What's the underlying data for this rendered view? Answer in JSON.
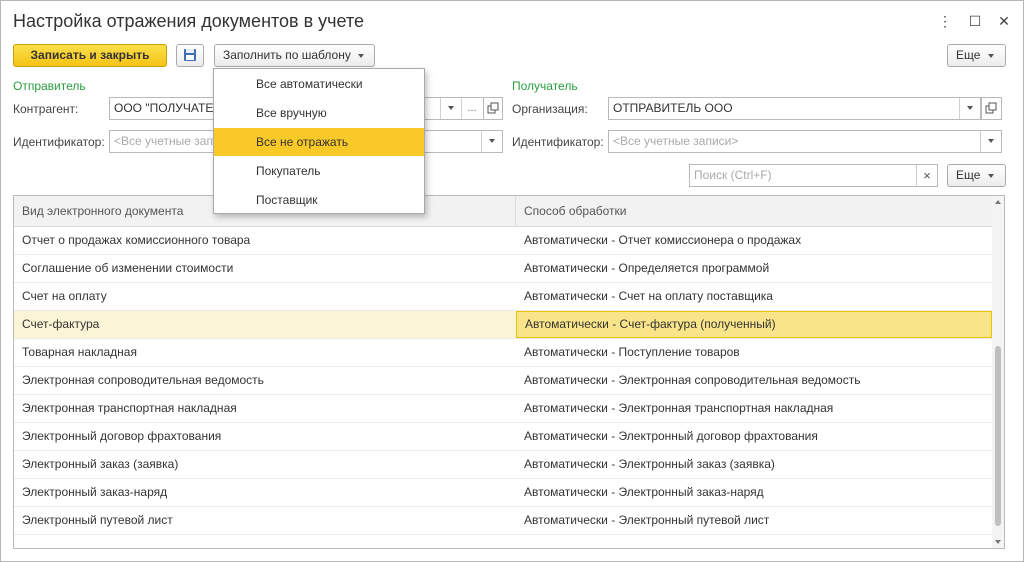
{
  "window": {
    "title": "Настройка отражения документов в учете",
    "menu_icon": "⋮",
    "maximize_icon": "☐",
    "close_icon": "✕"
  },
  "toolbar": {
    "save_close_label": "Записать и закрыть",
    "save_icon": "floppy-disk-icon",
    "fill_template_label": "Заполнить по шаблону",
    "more_label": "Еще"
  },
  "template_menu": {
    "items": [
      "Все автоматически",
      "Все вручную",
      "Все не отражать",
      "Покупатель",
      "Поставщик"
    ],
    "highlighted_index": 2
  },
  "sender": {
    "section_title": "Отправитель",
    "counterparty_label": "Контрагент:",
    "counterparty_value": "ООО \"ПОЛУЧАТЕЛЬ\"",
    "identifier_label": "Идентификатор:",
    "identifier_placeholder": "<Все учетные записи>"
  },
  "receiver": {
    "section_title": "Получатель",
    "organization_label": "Организация:",
    "organization_value": "ОТПРАВИТЕЛЬ ООО",
    "identifier_label": "Идентификатор:",
    "identifier_placeholder": "<Все учетные записи>"
  },
  "search": {
    "placeholder": "Поиск (Ctrl+F)",
    "clear_icon": "×",
    "more_label": "Еще"
  },
  "table": {
    "columns": [
      "Вид электронного документа",
      "Способ обработки"
    ],
    "rows": [
      {
        "doc": "Отчет о продажах комиссионного товара",
        "method": "Автоматически -  Отчет комиссионера о продажах"
      },
      {
        "doc": "Соглашение об изменении стоимости",
        "method": "Автоматически -  Определяется программой"
      },
      {
        "doc": "Счет на оплату",
        "method": "Автоматически -  Счет на оплату поставщика"
      },
      {
        "doc": "Счет-фактура",
        "method": "Автоматически -  Счет-фактура (полученный)"
      },
      {
        "doc": "Товарная накладная",
        "method": "Автоматически -  Поступление товаров"
      },
      {
        "doc": "Электронная сопроводительная ведомость",
        "method": "Автоматически -  Электронная сопроводительная ведомость"
      },
      {
        "doc": "Электронная транспортная накладная",
        "method": "Автоматически -  Электронная транспортная накладная"
      },
      {
        "doc": "Электронный договор фрахтования",
        "method": "Автоматически -  Электронный договор фрахтования"
      },
      {
        "doc": "Электронный заказ (заявка)",
        "method": "Автоматически -  Электронный заказ (заявка)"
      },
      {
        "doc": "Электронный заказ-наряд",
        "method": "Автоматически -  Электронный заказ-наряд"
      },
      {
        "doc": "Электронный путевой лист",
        "method": "Автоматически -  Электронный путевой лист"
      }
    ],
    "selected_index": 3
  },
  "colors": {
    "accent_yellow": "#f9c928",
    "section_green": "#2a9d3f",
    "selected_row": "#fcf4d6"
  }
}
